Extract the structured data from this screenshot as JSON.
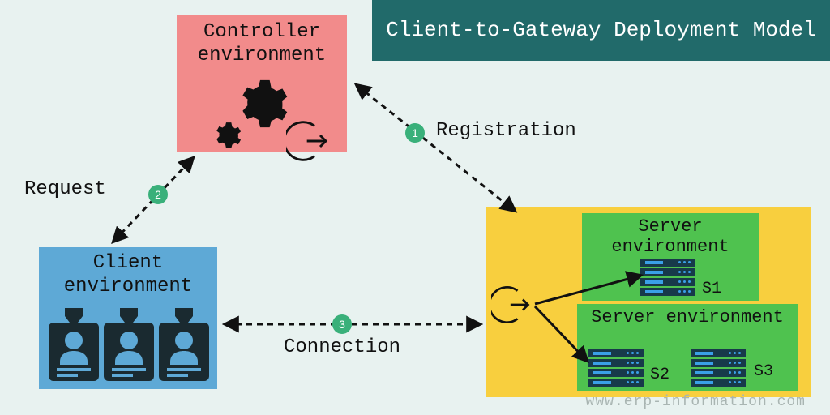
{
  "title": "Client-to-Gateway Deployment Model",
  "controller": {
    "label": "Controller environment"
  },
  "client": {
    "label": "Client environment"
  },
  "server1": {
    "label": "Server environment"
  },
  "server2": {
    "label": "Server environment"
  },
  "servers": {
    "s1": "S1",
    "s2": "S2",
    "s3": "S3"
  },
  "edges": {
    "request": {
      "num": "2",
      "label": "Request"
    },
    "registration": {
      "num": "1",
      "label": "Registration"
    },
    "connection": {
      "num": "3",
      "label": "Connection"
    }
  },
  "watermark": "www.erp-information.com",
  "colors": {
    "bg": "#e8f2f0",
    "banner": "#216a6a",
    "controller": "#f28b8b",
    "client": "#5ea9d6",
    "gateway": "#f8cf3e",
    "server": "#4fc24f",
    "badge": "#39b07a"
  }
}
